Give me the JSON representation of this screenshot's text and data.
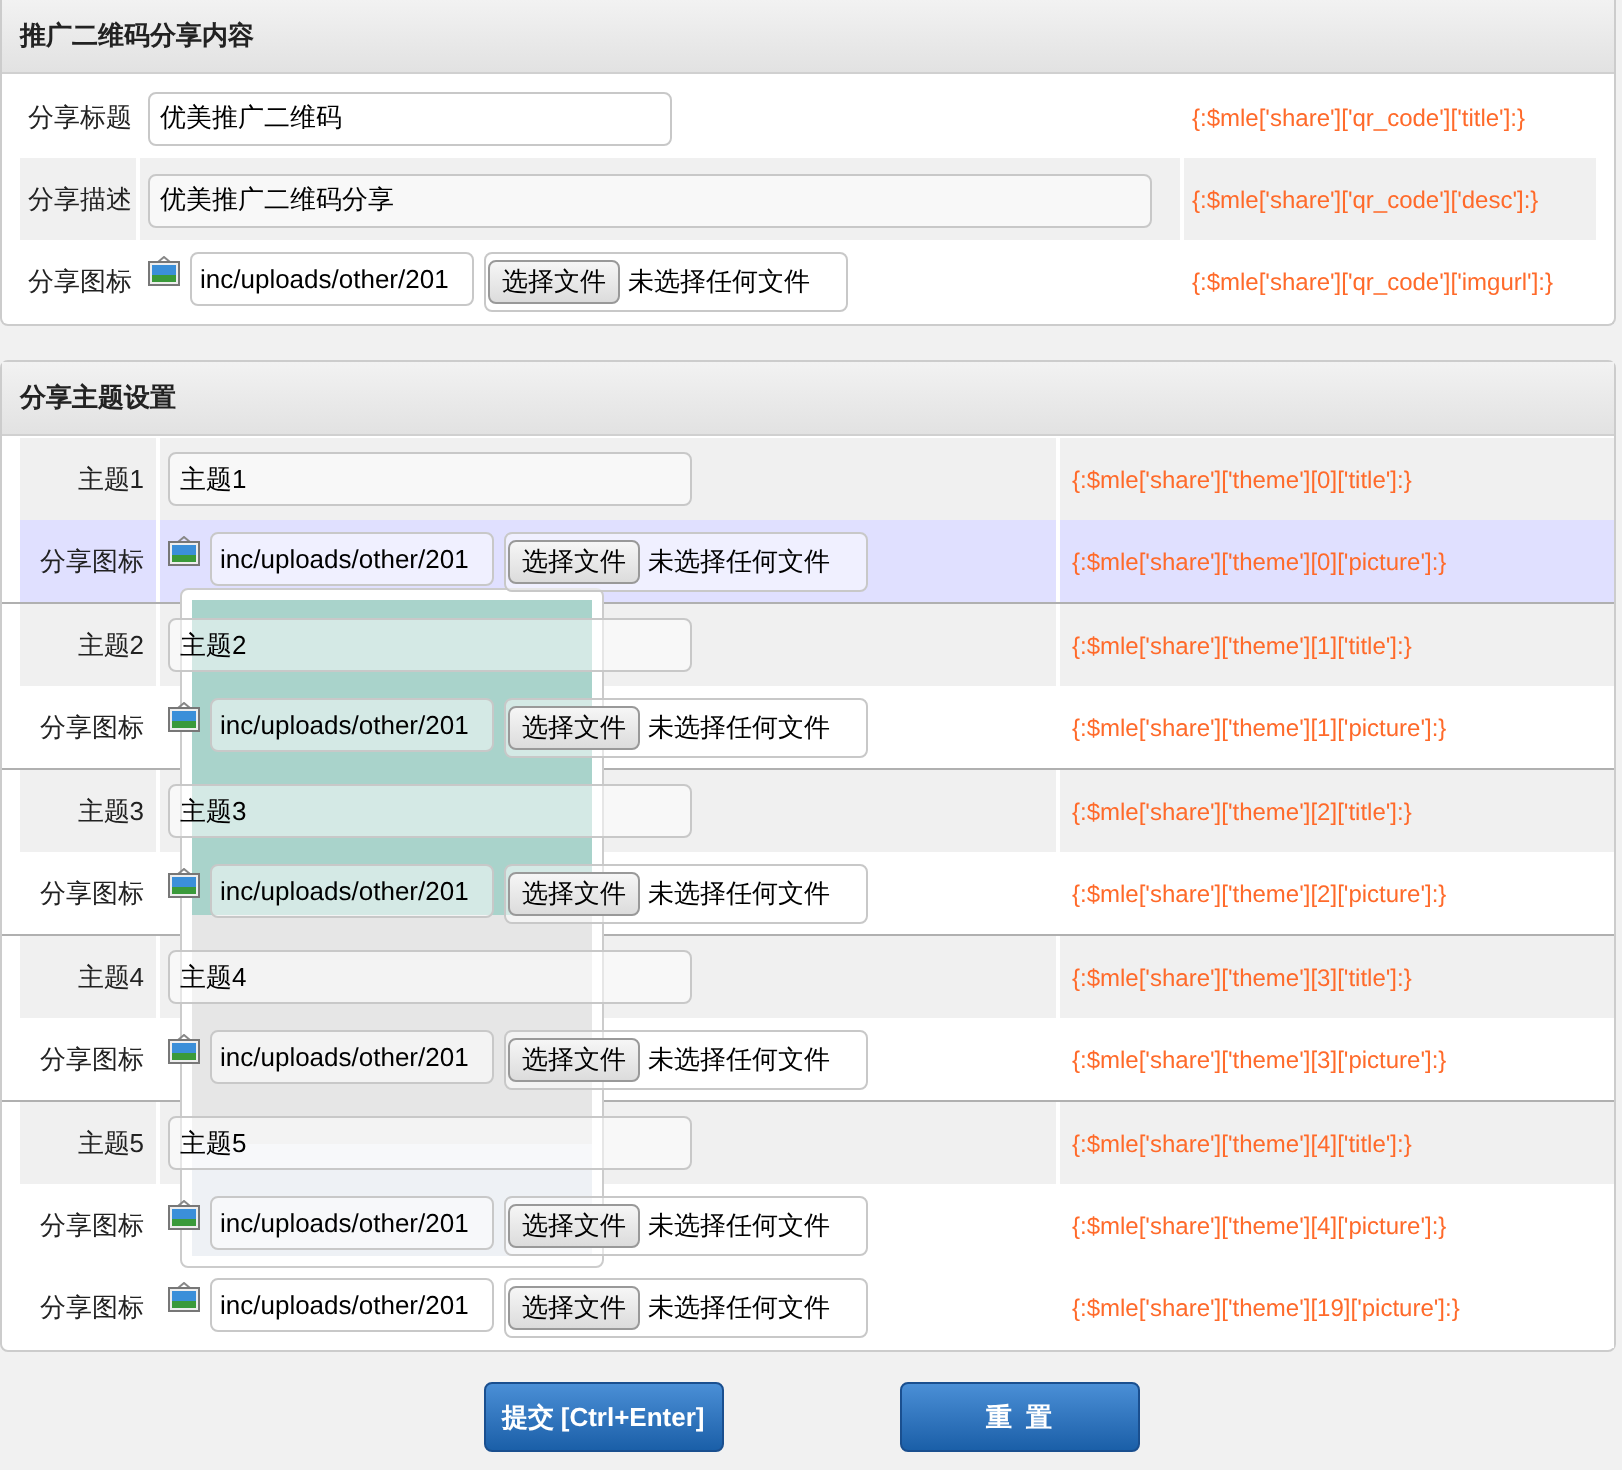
{
  "qr_section": {
    "title": "推广二维码分享内容",
    "rows": [
      {
        "kind": "text",
        "label": "分享标题",
        "value": "优美推广二维码",
        "wide": false,
        "note": "{:$mle['share']['qr_code']['title']:}"
      },
      {
        "kind": "text",
        "label": "分享描述",
        "value": "优美推广二维码分享",
        "wide": true,
        "note": "{:$mle['share']['qr_code']['desc']:}"
      },
      {
        "kind": "file",
        "label": "分享图标",
        "value": "inc/uploads/other/201",
        "button": "选择文件",
        "status": "未选择任何文件",
        "note": "{:$mle['share']['qr_code']['imgurl']:}"
      }
    ]
  },
  "theme_section": {
    "title": "分享主题设置",
    "rows": [
      {
        "kind": "text",
        "label": "主题1",
        "value": "主题1",
        "selected": false,
        "note": "{:$mle['share']['theme'][0]['title']:}"
      },
      {
        "kind": "file",
        "label": "分享图标",
        "value": "inc/uploads/other/201",
        "button": "选择文件",
        "status": "未选择任何文件",
        "selected": true,
        "note": "{:$mle['share']['theme'][0]['picture']:}"
      },
      {
        "kind": "text",
        "label": "主题2",
        "value": "主题2",
        "selected": false,
        "note": "{:$mle['share']['theme'][1]['title']:}"
      },
      {
        "kind": "file",
        "label": "分享图标",
        "value": "inc/uploads/other/201",
        "button": "选择文件",
        "status": "未选择任何文件",
        "selected": false,
        "note": "{:$mle['share']['theme'][1]['picture']:}"
      },
      {
        "kind": "text",
        "label": "主题3",
        "value": "主题3",
        "selected": false,
        "note": "{:$mle['share']['theme'][2]['title']:}"
      },
      {
        "kind": "file",
        "label": "分享图标",
        "value": "inc/uploads/other/201",
        "button": "选择文件",
        "status": "未选择任何文件",
        "selected": false,
        "note": "{:$mle['share']['theme'][2]['picture']:}"
      },
      {
        "kind": "text",
        "label": "主题4",
        "value": "主题4",
        "selected": false,
        "note": "{:$mle['share']['theme'][3]['title']:}"
      },
      {
        "kind": "file",
        "label": "分享图标",
        "value": "inc/uploads/other/201",
        "button": "选择文件",
        "status": "未选择任何文件",
        "selected": false,
        "note": "{:$mle['share']['theme'][3]['picture']:}"
      },
      {
        "kind": "text",
        "label": "主题5",
        "value": "主题5",
        "selected": false,
        "note": "{:$mle['share']['theme'][4]['title']:}"
      },
      {
        "kind": "file",
        "label": "分享图标",
        "value": "inc/uploads/other/201",
        "button": "选择文件",
        "status": "未选择任何文件",
        "selected": false,
        "note": "{:$mle['share']['theme'][4]['picture']:}"
      },
      {
        "kind": "file",
        "label": "分享图标",
        "value": "inc/uploads/other/201",
        "button": "选择文件",
        "status": "未选择任何文件",
        "selected": false,
        "note": "{:$mle['share']['theme'][19]['picture']:}"
      }
    ]
  },
  "buttons": [
    "提交 [Ctrl+Enter]",
    "重  置"
  ]
}
